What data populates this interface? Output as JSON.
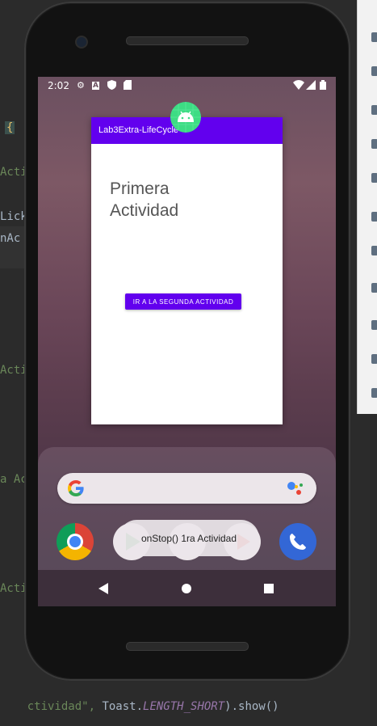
{
  "ide": {
    "fragments": [
      "{",
      "Acti",
      "Lick",
      "nAc",
      "Acti",
      "a Ac",
      "Acti"
    ],
    "bottom_code": {
      "prefix": "ctividad\", ",
      "toast": "Toast.",
      "const": "LENGTH_SHORT",
      "suffix": ").show()"
    }
  },
  "statusbar": {
    "time": "2:02",
    "icons": [
      "settings-icon",
      "font-icon",
      "shield-icon",
      "sd-card-icon",
      "wifi-icon",
      "signal-icon",
      "battery-icon"
    ]
  },
  "app": {
    "title": "Lab3Extra-LifeCycle",
    "heading": "Primera\nActividad",
    "button_label": "IR A LA SEGUNDA ACTIVIDAD",
    "primary_color": "#6200ee"
  },
  "launcher": {
    "dock_apps": [
      "chrome-icon",
      "play-store-icon",
      "photos-icon",
      "play-icon",
      "phone-icon"
    ]
  },
  "toast": {
    "message": "onStop() 1ra Actividad"
  }
}
